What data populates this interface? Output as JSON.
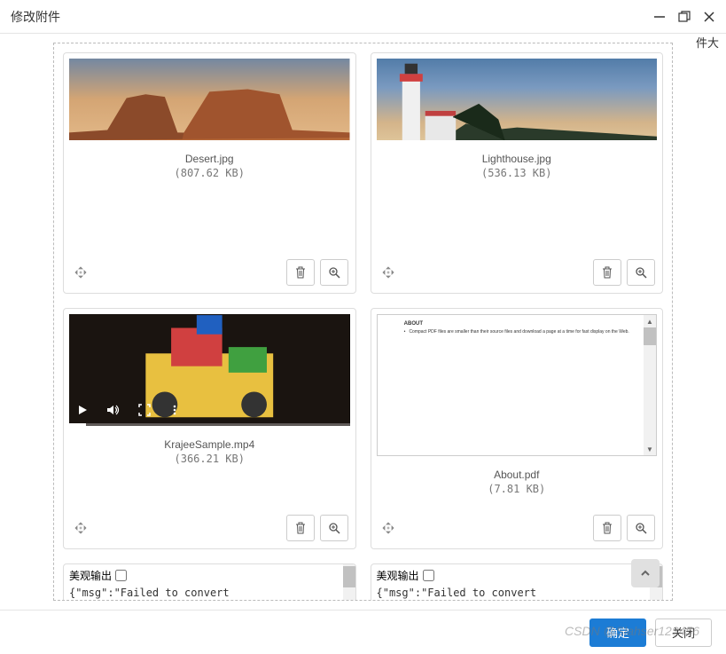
{
  "window": {
    "title": "修改附件"
  },
  "files": [
    {
      "name": "Desert.jpg",
      "size": "(807.62 KB)"
    },
    {
      "name": "Lighthouse.jpg",
      "size": "(536.13 KB)"
    },
    {
      "name": "KrajeeSample.mp4",
      "size": "(366.21 KB)"
    },
    {
      "name": "About.pdf",
      "size": "(7.81 KB)"
    }
  ],
  "pdf_preview": {
    "heading": "ABOUT",
    "bullet": "Compact PDF files are smaller than their source files and download a page at a time for fast display on the Web."
  },
  "json_output": {
    "label": "美观输出",
    "content": "{\"msg\":\"Failed to convert"
  },
  "buttons": {
    "confirm": "确定",
    "cancel": "关闭"
  },
  "side": {
    "partial_text": "件大"
  },
  "watermark": "CSDN @Slahser123456"
}
